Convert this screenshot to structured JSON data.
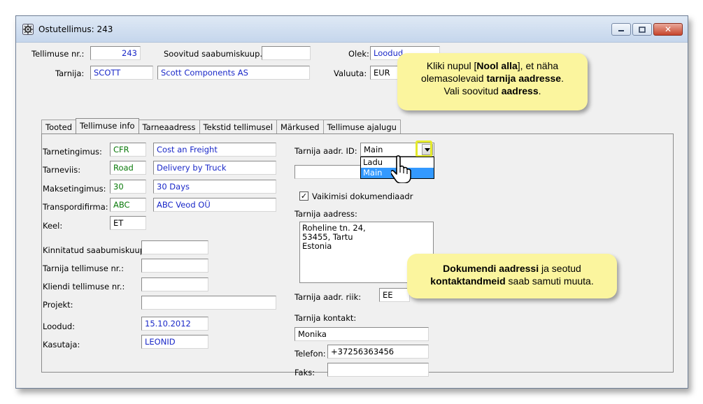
{
  "window": {
    "title": "Ostutellimus: 243",
    "icon": "gear-app-icon",
    "controls": {
      "minimize_icon": "minimize-icon",
      "maximize_icon": "maximize-icon",
      "close_icon": "close-icon"
    }
  },
  "header": {
    "order_no_label": "Tellimuse nr.:",
    "order_no_value": "243",
    "desired_arrival_label": "Soovitud saabumiskuup.:",
    "desired_arrival_value": "",
    "status_label": "Olek:",
    "status_value": "Loodud",
    "supplier_label": "Tarnija:",
    "supplier_code": "SCOTT",
    "supplier_name": "Scott Components AS",
    "currency_label": "Valuuta:",
    "currency_value": "EUR"
  },
  "tabs": [
    {
      "label": "Tooted"
    },
    {
      "label": "Tellimuse info"
    },
    {
      "label": "Tarneaadress"
    },
    {
      "label": "Tekstid tellimusel"
    },
    {
      "label": "Märkused"
    },
    {
      "label": "Tellimuse ajalugu"
    }
  ],
  "left": {
    "delivery_terms_label": "Tarnetingimus:",
    "delivery_terms_code": "CFR",
    "delivery_terms_text": "Cost an Freight",
    "delivery_method_label": "Tarneviis:",
    "delivery_method_code": "Road",
    "delivery_method_text": "Delivery by Truck",
    "payment_terms_label": "Maksetingimus:",
    "payment_terms_code": "30",
    "payment_terms_text": "30 Days",
    "transport_company_label": "Transpordifirma:",
    "transport_company_code": "ABC",
    "transport_company_text": "ABC Veod OÜ",
    "language_label": "Keel:",
    "language_value": "ET",
    "confirmed_arrival_label": "Kinnitatud saabumiskuup.:",
    "confirmed_arrival_value": "",
    "supplier_order_no_label": "Tarnija tellimuse nr.:",
    "supplier_order_no_value": "",
    "customer_order_no_label": "Kliendi tellimuse nr.:",
    "customer_order_no_value": "",
    "project_label": "Projekt:",
    "project_value": "",
    "created_label": "Loodud:",
    "created_value": "15.10.2012",
    "user_label": "Kasutaja:",
    "user_value": "LEONID"
  },
  "right": {
    "supplier_addr_id_label": "Tarnija aadr. ID:",
    "supplier_addr_id_value": "Main",
    "dropdown_options": [
      "Ladu",
      "Main"
    ],
    "selected_option": "Main",
    "default_doc_addr_label": "Vaikimisi dokumendiaadr",
    "default_doc_addr_checked": true,
    "supplier_address_label": "Tarnija aadress:",
    "supplier_address_lines": [
      "Roheline tn. 24,",
      "53455, Tartu",
      "Estonia"
    ],
    "supplier_country_label": "Tarnija aadr. riik:",
    "supplier_country_value": "EE",
    "supplier_contact_label": "Tarnija kontakt:",
    "supplier_contact_value": "Monika",
    "phone_label": "Telefon:",
    "phone_value": "+37256363456",
    "fax_label": "Faks:",
    "fax_value": ""
  },
  "callouts": {
    "top": {
      "line1_a": "Kliki nupul [",
      "line1_b": "Nool alla",
      "line1_c": "], et näha",
      "line2_a": "olemasolevaid ",
      "line2_b": "tarnija aadresse",
      "line2_c": ".",
      "line3_a": "Vali soovitud ",
      "line3_b": "aadress",
      "line3_c": "."
    },
    "bottom": {
      "line1_a": "Dokumendi aadressi",
      "line1_b": " ja seotud",
      "line2_a": "kontaktandmeid",
      "line2_b": " saab samuti muuta."
    }
  },
  "icons": {
    "combo_arrow": "chevron-down-icon",
    "cursor": "hand-pointer-icon"
  }
}
